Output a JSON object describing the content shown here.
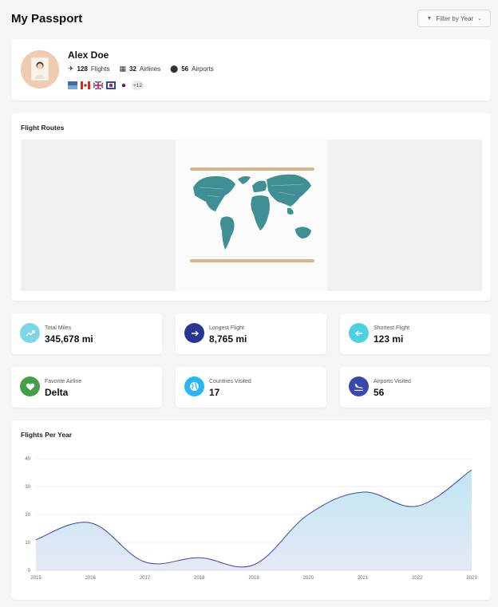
{
  "page": {
    "title": "My Passport"
  },
  "filter": {
    "label": "Filter by Year",
    "icon": "filter-icon"
  },
  "profile": {
    "name": "Alex Doe",
    "flights_count": "128",
    "flights_label": "Flights",
    "airlines_count": "32",
    "airlines_label": "Airlines",
    "airports_count": "56",
    "airports_label": "Airports",
    "flags": [
      "flag-1",
      "flag-canada",
      "flag-uk",
      "flag-4",
      "flag-south-korea"
    ],
    "flags_more": "+12"
  },
  "routes": {
    "title": "Flight Routes"
  },
  "stats": [
    {
      "label": "Total Miles",
      "value": "345,678 mi",
      "icon": "trending-up-icon",
      "color": "#7dd6e8"
    },
    {
      "label": "Longest Flight",
      "value": "8,765 mi",
      "icon": "arrow-right-icon",
      "color": "#283593"
    },
    {
      "label": "Shortest Flight",
      "value": "123 mi",
      "icon": "arrow-left-icon",
      "color": "#4dd0e1"
    },
    {
      "label": "Favorite Airline",
      "value": "Delta",
      "icon": "heart-icon",
      "color": "#43a047"
    },
    {
      "label": "Countries Visited",
      "value": "17",
      "icon": "globe-icon",
      "color": "#29b6f6"
    },
    {
      "label": "Airports Visited",
      "value": "56",
      "icon": "plane-landing-icon",
      "color": "#3949ab"
    }
  ],
  "chart_data": {
    "type": "area",
    "title": "Flights Per Year",
    "x": [
      "2015",
      "2016",
      "2017",
      "2018",
      "2019",
      "2020",
      "2021",
      "2022",
      "2023"
    ],
    "values": [
      11,
      17,
      3,
      4.5,
      2,
      20,
      28,
      23,
      36
    ],
    "ylim": [
      0,
      40
    ],
    "yticks": [
      0,
      10,
      20,
      30,
      40
    ],
    "xlabel": "",
    "ylabel": "",
    "line_color": "#3949ab",
    "fill_top": "#bfe6f2",
    "fill_bottom": "#e6e8f7",
    "grid": true,
    "legend": false
  }
}
